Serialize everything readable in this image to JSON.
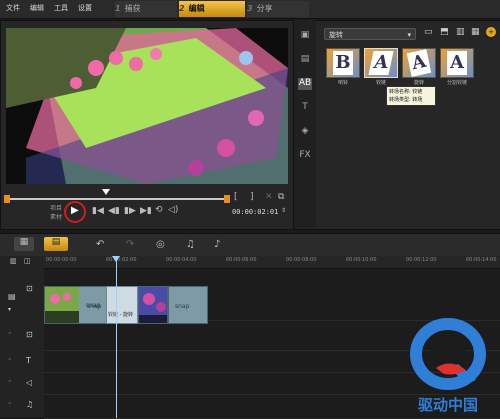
{
  "menu": [
    "文件",
    "编辑",
    "工具",
    "设置"
  ],
  "steps": [
    {
      "num": "1",
      "label": "捕获",
      "active": false
    },
    {
      "num": "2",
      "label": "编辑",
      "active": true
    },
    {
      "num": "3",
      "label": "分享",
      "active": false
    }
  ],
  "preview": {
    "timecode": "00:00:02:01",
    "label_top": "项目",
    "label_bottom": "素材"
  },
  "library": {
    "dropdown": "旋转",
    "thumbs": [
      {
        "glyph": "B",
        "label": "响铃"
      },
      {
        "glyph": "A",
        "label": "铰链"
      },
      {
        "glyph": "A",
        "label": "旋转"
      },
      {
        "glyph": "A",
        "label": "分割铰链"
      }
    ],
    "tooltip_line1": "转场名称: 铰链",
    "tooltip_line2": "转场类型: 转场"
  },
  "timeline": {
    "ruler": [
      "00:00:00:00",
      "00:00:02:00",
      "00:00:04:00",
      "00:00:06:00",
      "00:00:08:00",
      "00:00:10:00",
      "00:00:12:00",
      "00:00:14:00"
    ],
    "clips": [
      {
        "caption": "snap"
      },
      {
        "caption": "snap"
      },
      {
        "caption": "snap"
      }
    ],
    "transition_label": "铰链 - 旋转"
  },
  "watermark": "驱动中国",
  "colors": {
    "accent": "#f3c44a",
    "playhead": "#9fd3ff",
    "clip": "#7e9aa6"
  }
}
